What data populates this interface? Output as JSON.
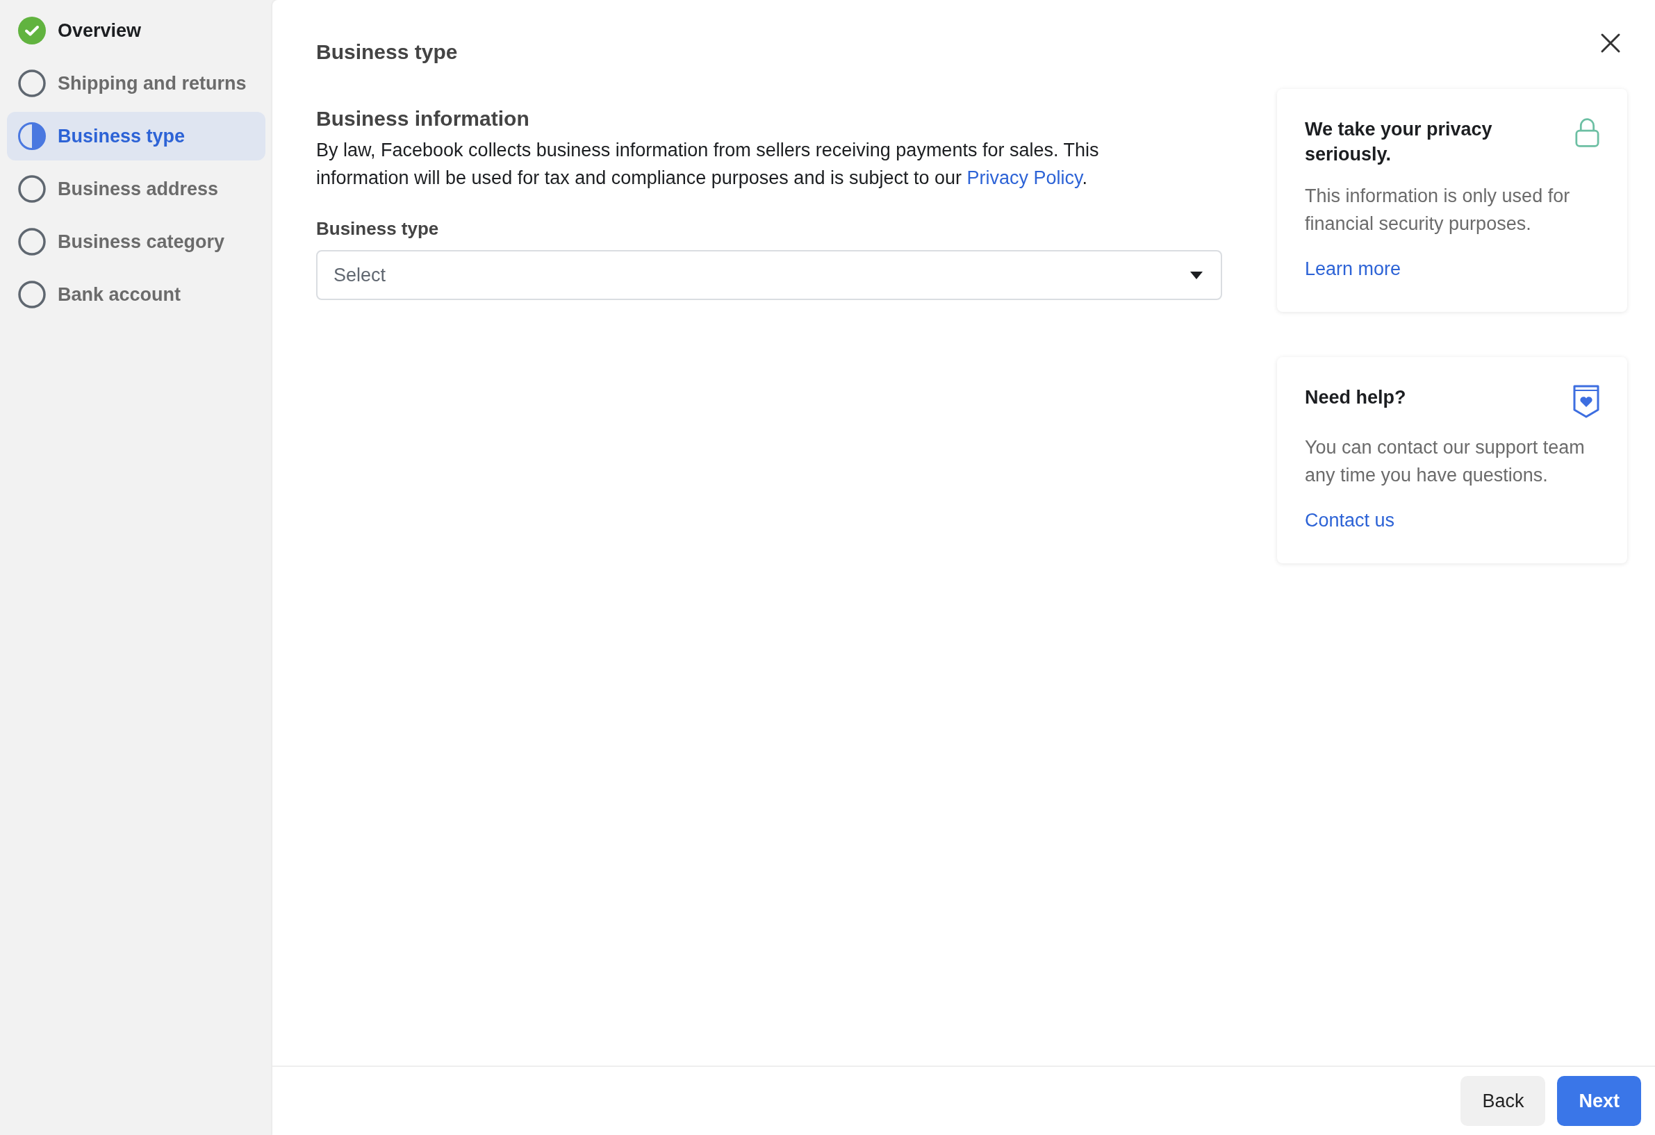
{
  "steps": [
    {
      "label": "Overview",
      "kind": "complete",
      "selected": false
    },
    {
      "label": "Shipping and returns",
      "kind": "pending",
      "selected": false
    },
    {
      "label": "Business type",
      "kind": "current",
      "selected": true
    },
    {
      "label": "Business address",
      "kind": "pending",
      "selected": false
    },
    {
      "label": "Business category",
      "kind": "pending",
      "selected": false
    },
    {
      "label": "Bank account",
      "kind": "pending",
      "selected": false
    }
  ],
  "page_title": "Business type",
  "section": {
    "heading": "Business information",
    "text": "By law, Facebook collects business information from sellers receiving payments for sales. This information will be used for tax and compliance purposes and is subject to our ",
    "link": "Privacy Policy",
    "text_end": "."
  },
  "field": {
    "label": "Business type",
    "placeholder": "Select"
  },
  "cards": [
    {
      "kind": "lock",
      "title": "We take your privacy seriously.",
      "text": "This information is only used for financial security purposes.",
      "link": "Learn more"
    },
    {
      "kind": "support",
      "title": "Need help?",
      "text": "You can contact our support team any time you have questions.",
      "link": "Contact us"
    }
  ],
  "buttons": {
    "back": "Back",
    "next": "Next"
  }
}
